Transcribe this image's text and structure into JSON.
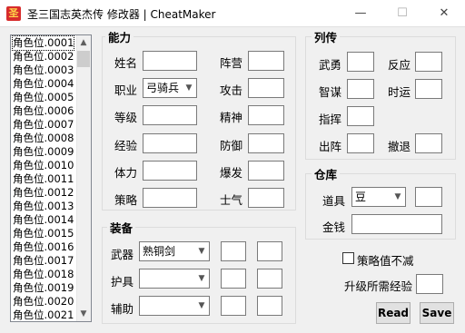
{
  "window": {
    "title": "圣三国志英杰传 修改器 | CheatMaker",
    "minimize": "—",
    "maximize": "☐",
    "close": "✕"
  },
  "character_list": [
    "角色位.0001",
    "角色位.0002",
    "角色位.0003",
    "角色位.0004",
    "角色位.0005",
    "角色位.0006",
    "角色位.0007",
    "角色位.0008",
    "角色位.0009",
    "角色位.0010",
    "角色位.0011",
    "角色位.0012",
    "角色位.0013",
    "角色位.0014",
    "角色位.0015",
    "角色位.0016",
    "角色位.0017",
    "角色位.0018",
    "角色位.0019",
    "角色位.0020",
    "角色位.0021"
  ],
  "ability": {
    "title": "能力",
    "name_label": "姓名",
    "job_label": "职业",
    "job_value": "弓骑兵",
    "level_label": "等级",
    "exp_label": "经验",
    "hp_label": "体力",
    "strategy_label": "策略",
    "camp_label": "阵营",
    "attack_label": "攻击",
    "spirit_label": "精神",
    "defense_label": "防御",
    "burst_label": "爆发",
    "morale_label": "士气"
  },
  "biography": {
    "title": "列传",
    "valor_label": "武勇",
    "response_label": "反应",
    "wisdom_label": "智谋",
    "fortune_label": "时运",
    "command_label": "指挥",
    "deploy_label": "出阵",
    "retreat_label": "撤退"
  },
  "equipment": {
    "title": "装备",
    "weapon_label": "武器",
    "weapon_value": "熟铜剑",
    "armor_label": "护具",
    "armor_value": "",
    "aux_label": "辅助",
    "aux_value": ""
  },
  "warehouse": {
    "title": "仓库",
    "item_label": "道具",
    "item_value": "豆",
    "money_label": "金钱"
  },
  "options": {
    "strategy_lock_label": "策略值不减",
    "levelup_exp_label": "升级所需经验"
  },
  "buttons": {
    "read": "Read",
    "save": "Save"
  },
  "icons": {
    "app": "app-icon",
    "dropdown": "chevron-down-icon",
    "scroll_up": "scroll-up-icon",
    "scroll_down": "scroll-down-icon"
  }
}
